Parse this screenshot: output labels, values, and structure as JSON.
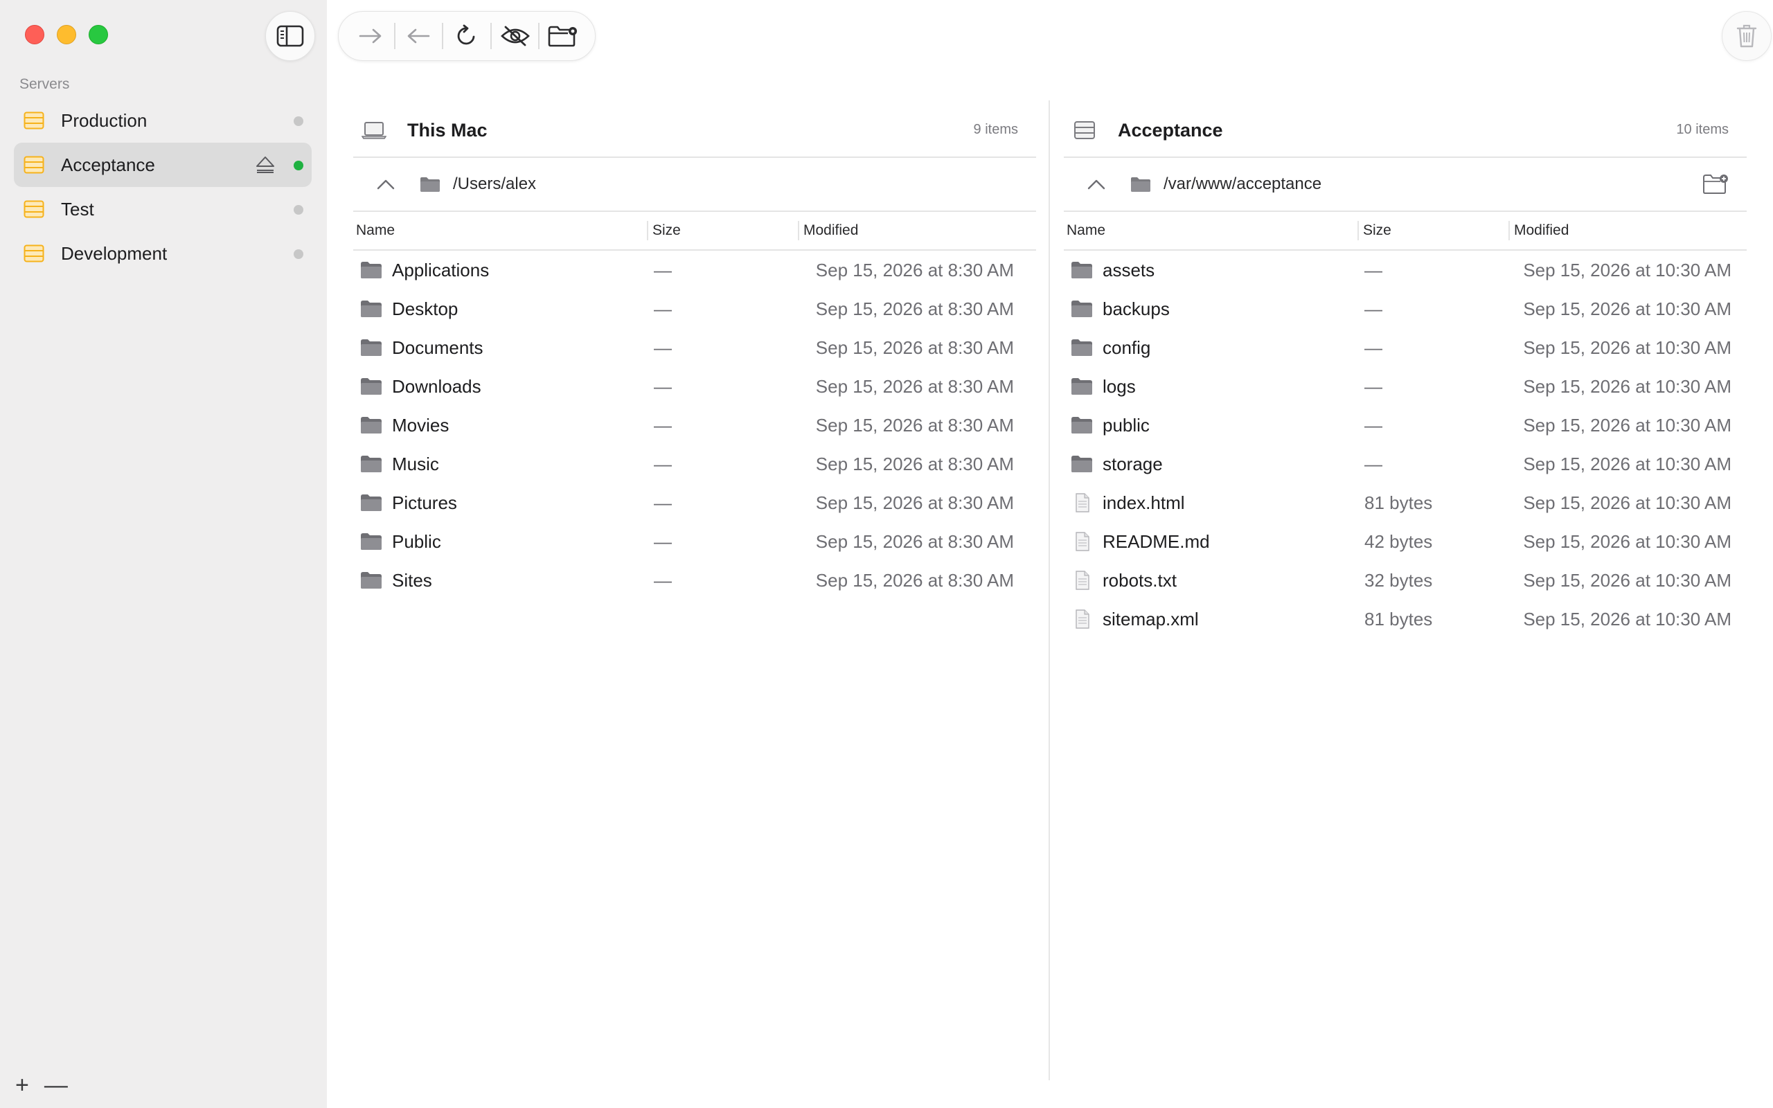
{
  "sidebar": {
    "section_label": "Servers",
    "servers": [
      {
        "label": "Production",
        "status": "offline"
      },
      {
        "label": "Acceptance",
        "status": "online",
        "selected": true
      },
      {
        "label": "Test",
        "status": "offline"
      },
      {
        "label": "Development",
        "status": "offline"
      }
    ],
    "add_label": "+",
    "remove_label": "—"
  },
  "colors": {
    "accent_server_icon": "#f6b21b",
    "online": "#1fb141",
    "offline": "#c7c7c7",
    "selected_row": "#dcdcdc"
  },
  "toolbar": {
    "icons": [
      "arrow-right-icon",
      "arrow-left-icon",
      "refresh-icon",
      "hidden-files-icon",
      "new-folder-settings-icon"
    ]
  },
  "left_pane": {
    "title": "This Mac",
    "count": "9 items",
    "path": "/Users/alex",
    "columns": {
      "name": "Name",
      "size": "Size",
      "modified": "Modified"
    },
    "rows": [
      {
        "name": "Applications",
        "size": "—",
        "modified": "Sep 15, 2026 at 8:30 AM"
      },
      {
        "name": "Desktop",
        "size": "—",
        "modified": "Sep 15, 2026 at 8:30 AM"
      },
      {
        "name": "Documents",
        "size": "—",
        "modified": "Sep 15, 2026 at 8:30 AM"
      },
      {
        "name": "Downloads",
        "size": "—",
        "modified": "Sep 15, 2026 at 8:30 AM"
      },
      {
        "name": "Movies",
        "size": "—",
        "modified": "Sep 15, 2026 at 8:30 AM"
      },
      {
        "name": "Music",
        "size": "—",
        "modified": "Sep 15, 2026 at 8:30 AM"
      },
      {
        "name": "Pictures",
        "size": "—",
        "modified": "Sep 15, 2026 at 8:30 AM"
      },
      {
        "name": "Public",
        "size": "—",
        "modified": "Sep 15, 2026 at 8:30 AM"
      },
      {
        "name": "Sites",
        "size": "—",
        "modified": "Sep 15, 2026 at 8:30 AM"
      }
    ]
  },
  "right_pane": {
    "title": "Acceptance",
    "count": "10 items",
    "path": "/var/www/acceptance",
    "columns": {
      "name": "Name",
      "size": "Size",
      "modified": "Modified"
    },
    "rows": [
      {
        "name": "assets",
        "size": "—",
        "modified": "Sep 15, 2026 at 10:30 AM",
        "kind": "folder"
      },
      {
        "name": "backups",
        "size": "—",
        "modified": "Sep 15, 2026 at 10:30 AM",
        "kind": "folder"
      },
      {
        "name": "config",
        "size": "—",
        "modified": "Sep 15, 2026 at 10:30 AM",
        "kind": "folder"
      },
      {
        "name": "logs",
        "size": "—",
        "modified": "Sep 15, 2026 at 10:30 AM",
        "kind": "folder"
      },
      {
        "name": "public",
        "size": "—",
        "modified": "Sep 15, 2026 at 10:30 AM",
        "kind": "folder"
      },
      {
        "name": "storage",
        "size": "—",
        "modified": "Sep 15, 2026 at 10:30 AM",
        "kind": "folder"
      },
      {
        "name": "index.html",
        "size": "81 bytes",
        "modified": "Sep 15, 2026 at 10:30 AM",
        "kind": "file"
      },
      {
        "name": "README.md",
        "size": "42 bytes",
        "modified": "Sep 15, 2026 at 10:30 AM",
        "kind": "file"
      },
      {
        "name": "robots.txt",
        "size": "32 bytes",
        "modified": "Sep 15, 2026 at 10:30 AM",
        "kind": "file"
      },
      {
        "name": "sitemap.xml",
        "size": "81 bytes",
        "modified": "Sep 15, 2026 at 10:30 AM",
        "kind": "file"
      }
    ]
  }
}
